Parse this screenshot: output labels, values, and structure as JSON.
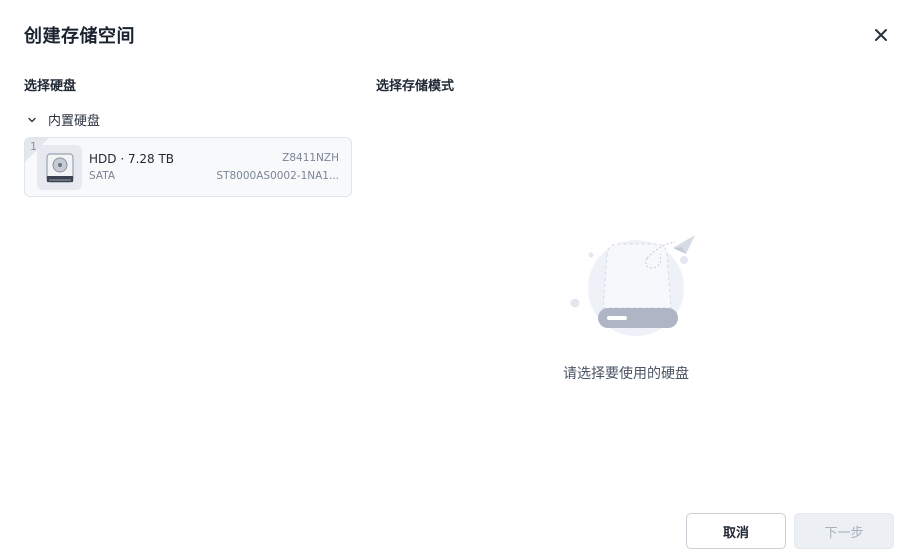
{
  "dialog": {
    "title": "创建存储空间",
    "close_icon": "close-icon"
  },
  "left": {
    "section_label": "选择硬盘",
    "group": {
      "label": "内置硬盘",
      "expanded": true,
      "toggle_icon": "chevron-down-icon"
    },
    "disks": [
      {
        "slot": "1",
        "name": "HDD · 7.28 TB",
        "interface": "SATA",
        "serial": "Z8411NZH",
        "model": "ST8000AS0002-1NA1...",
        "icon": "hard-drive-icon"
      }
    ]
  },
  "right": {
    "section_label": "选择存储模式",
    "empty_message": "请选择要使用的硬盘",
    "illustration_icon": "empty-disk-illustration"
  },
  "footer": {
    "cancel_label": "取消",
    "next_label": "下一步",
    "next_enabled": false
  },
  "colors": {
    "text_primary": "#1f2733",
    "text_secondary": "#7a8596",
    "card_border": "#dfe3ea",
    "disabled_bg": "#eceff4",
    "disabled_text": "#a9b0bc"
  }
}
